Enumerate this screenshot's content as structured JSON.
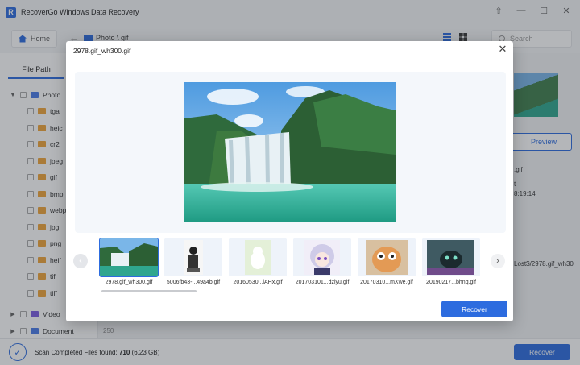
{
  "app": {
    "title": "RecoverGo Windows Data Recovery"
  },
  "toolbar": {
    "home_label": "Home",
    "path": "Photo \\ gif",
    "search_placeholder": "Search"
  },
  "sidebar": {
    "tab_label": "File Path",
    "root": "Photo",
    "items": [
      "tga",
      "heic",
      "cr2",
      "jpeg",
      "gif",
      "bmp",
      "webp",
      "jpg",
      "png",
      "heif",
      "tif",
      "tiff"
    ],
    "video": "Video",
    "document": "Document"
  },
  "background": {
    "preview_label": "Preview",
    "file_ext": ".gif",
    "time_fragment": "t",
    "time_value": "8:19:14",
    "path_fragment": "Lost$/2978.gif_wh30",
    "row_count": "250"
  },
  "status": {
    "prefix": "Scan Completed Files found:",
    "count": "710",
    "size": "(6.23 GB)"
  },
  "bg_recover_label": "Recover",
  "modal": {
    "title": "2978.gif_wh300.gif",
    "recover_label": "Recover",
    "thumbnails": [
      "2978.gif_wh300.gif",
      "5006fb43-...49a4b.gif",
      "20160530...lAHx.gif",
      "201703101...dzlyu.gif",
      "20170310...mXwe.gif",
      "20190217...bhnq.gif"
    ]
  },
  "colors": {
    "accent": "#2d6cdf",
    "folder": "#f0a53a"
  }
}
